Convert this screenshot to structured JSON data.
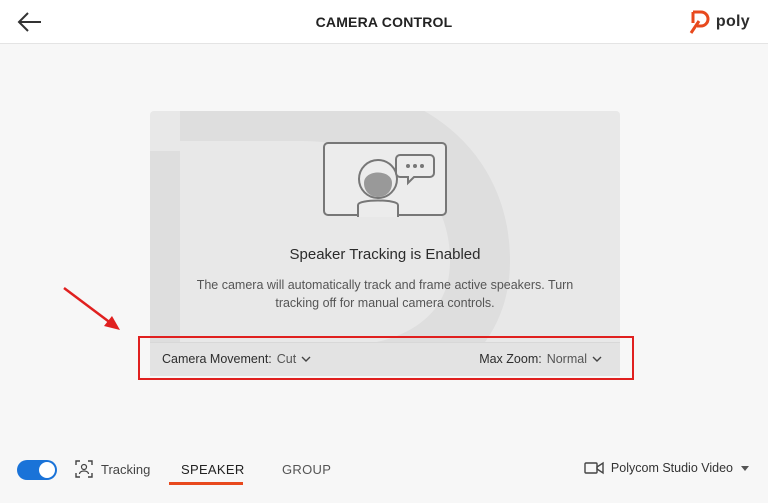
{
  "header": {
    "title": "CAMERA CONTROL",
    "brand_name": "poly",
    "back_icon": "arrow-left-icon",
    "brand_logo_icon": "poly-logo-icon"
  },
  "card": {
    "heading": "Speaker Tracking is Enabled",
    "description": "The camera will automatically track and frame active speakers. Turn tracking off for manual camera controls.",
    "illustration_icon": "speaker-on-screen-icon"
  },
  "controls": {
    "camera_movement_label": "Camera Movement:",
    "camera_movement_value": "Cut",
    "max_zoom_label": "Max Zoom:",
    "max_zoom_value": "Normal"
  },
  "bottom": {
    "tracking_enabled": true,
    "tracking_label": "Tracking",
    "tracking_icon": "tracking-frame-icon",
    "tabs": [
      {
        "label": "SPEAKER",
        "active": true
      },
      {
        "label": "GROUP",
        "active": false
      }
    ],
    "device_label": "Polycom Studio Video",
    "device_icon": "video-camera-icon"
  },
  "colors": {
    "accent": "#1a73d8",
    "tab_underline": "#e8491d",
    "brand_orange": "#e8491d",
    "annotation_red": "#e0201f"
  }
}
